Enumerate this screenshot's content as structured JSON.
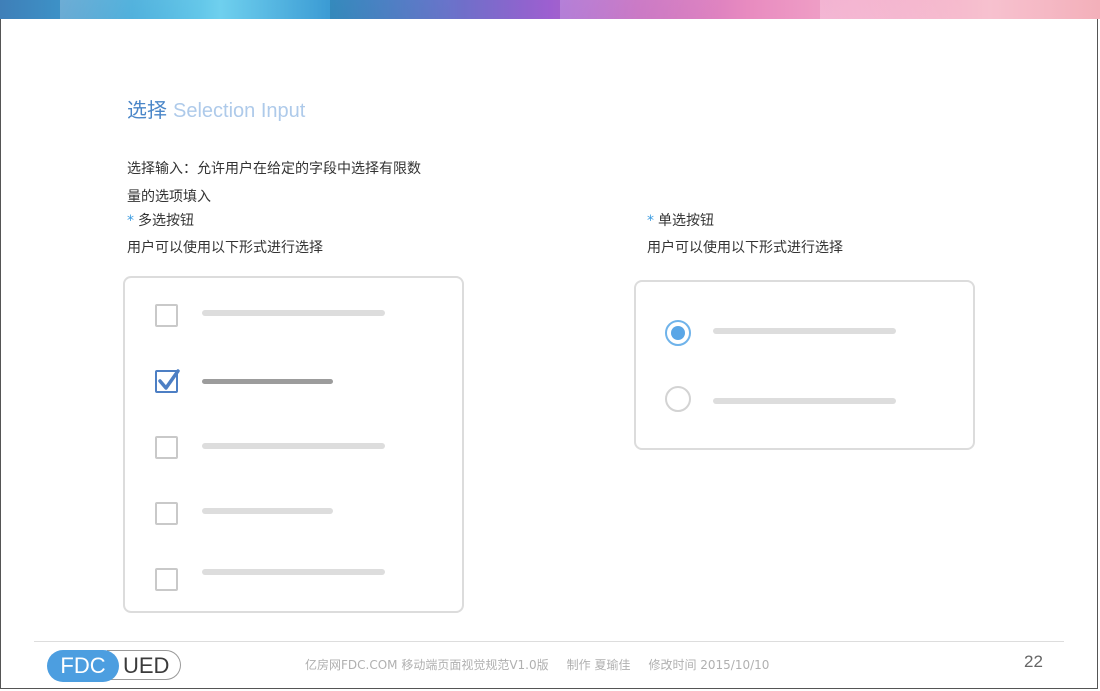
{
  "title": {
    "cn": "选择",
    "en": "Selection Input"
  },
  "description": {
    "line1": "选择输入：允许用户在给定的字段中选择有限数",
    "line2": "量的选项填入"
  },
  "checkbox_section": {
    "star": "*",
    "heading": "多选按钮",
    "subtext": "用户可以使用以下形式进行选择",
    "items": [
      {
        "checked": false
      },
      {
        "checked": true
      },
      {
        "checked": false
      },
      {
        "checked": false
      },
      {
        "checked": false
      }
    ]
  },
  "radio_section": {
    "star": "*",
    "heading": "单选按钮",
    "subtext": "用户可以使用以下形式进行选择",
    "items": [
      {
        "selected": true
      },
      {
        "selected": false
      }
    ]
  },
  "footer": {
    "logo_left": "FDC",
    "logo_right": "UED",
    "doc_name": "亿房网FDC.COM 移动端页面视觉规范V1.0版",
    "author": "制作 夏瑜佳",
    "modified": "修改时间  2015/10/10",
    "page_number": "22"
  },
  "colors": {
    "accent": "#4a86c8",
    "title_en": "#aecaea",
    "star": "#3a9be0",
    "radio_on": "#5aa6e6",
    "check": "#4d7fc4"
  }
}
